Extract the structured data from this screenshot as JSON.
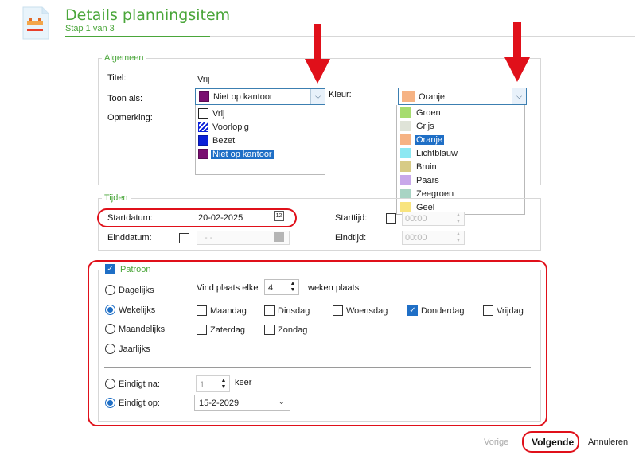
{
  "header": {
    "title": "Details planningsitem",
    "subtitle": "Stap 1 van 3"
  },
  "algemeen": {
    "legend": "Algemeen",
    "titel_label": "Titel:",
    "titel_value": "Vrij",
    "toon_als_label": "Toon als:",
    "toon_als_value": "Niet op kantoor",
    "toon_als_swatch": "#7a0f70",
    "opmerking_label": "Opmerking:",
    "kleur_label": "Kleur:",
    "kleur_value": "Oranje",
    "kleur_swatch": "#f6b384",
    "toon_als_options": [
      {
        "label": "Vrij",
        "color": "#ffffff"
      },
      {
        "label": "Voorlopig",
        "color": "hatch"
      },
      {
        "label": "Bezet",
        "color": "#0a1fd8"
      },
      {
        "label": "Niet op kantoor",
        "color": "#7a0f70"
      }
    ],
    "kleur_options": [
      {
        "label": "Groen",
        "color": "#a6dc6e"
      },
      {
        "label": "Grijs",
        "color": "#dfe3d8"
      },
      {
        "label": "Oranje",
        "color": "#f6b384"
      },
      {
        "label": "Lichtblauw",
        "color": "#8ce8f2"
      },
      {
        "label": "Bruin",
        "color": "#d7cb86"
      },
      {
        "label": "Paars",
        "color": "#c8a8ea"
      },
      {
        "label": "Zeegroen",
        "color": "#a8d4c4"
      },
      {
        "label": "Geel",
        "color": "#f8e47e"
      }
    ]
  },
  "tijden": {
    "legend": "Tijden",
    "startdatum_label": "Startdatum:",
    "startdatum_value": "20-02-2025",
    "einddatum_label": "Einddatum:",
    "einddatum_value": "-  -",
    "starttijd_label": "Starttijd:",
    "starttijd_value": "00:00",
    "eindtijd_label": "Eindtijd:",
    "eindtijd_value": "00:00",
    "calendar_glyph": "12"
  },
  "patroon": {
    "legend": "Patroon",
    "freq": [
      "Dagelijks",
      "Wekelijks",
      "Maandelijks",
      "Jaarlijks"
    ],
    "vind_plaats_label": "Vind plaats elke",
    "vind_plaats_value": "4",
    "weken_label": "weken plaats",
    "days": [
      {
        "label": "Maandag",
        "checked": false
      },
      {
        "label": "Dinsdag",
        "checked": false
      },
      {
        "label": "Woensdag",
        "checked": false
      },
      {
        "label": "Donderdag",
        "checked": true
      },
      {
        "label": "Vrijdag",
        "checked": false
      },
      {
        "label": "Zaterdag",
        "checked": false
      },
      {
        "label": "Zondag",
        "checked": false
      }
    ],
    "eindigt_na_label": "Eindigt na:",
    "eindigt_na_value": "1",
    "keer_label": "keer",
    "eindigt_op_label": "Eindigt op:",
    "eindigt_op_value": "15-2-2029"
  },
  "footer": {
    "vorige": "Vorige",
    "volgende": "Volgende",
    "annuleren": "Annuleren"
  },
  "colors": {
    "accent_green": "#4aa63a",
    "highlight_red": "#e0101a",
    "selection_blue": "#1f6fc6"
  }
}
